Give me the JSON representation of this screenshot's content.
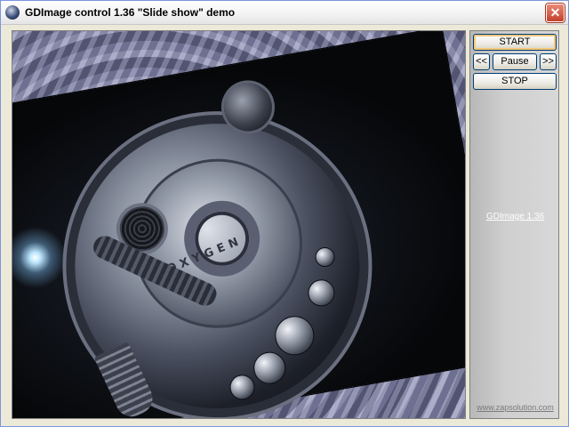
{
  "window": {
    "title": "GDImage control 1.36 \"Slide show\"  demo",
    "close_label": "✕"
  },
  "slide": {
    "logo_text": "OXYGEN"
  },
  "controls": {
    "start_label": "START",
    "prev_label": "<<",
    "pause_label": "Pause",
    "next_label": ">>",
    "stop_label": "STOP"
  },
  "links": {
    "version": "GDImage 1.36",
    "website": "www.zapsolution.com"
  },
  "colors": {
    "button_border": "#003c74",
    "focus_ring": "#f5c87a",
    "close_button": "#c4412b",
    "background_pattern": "#6e7196"
  }
}
